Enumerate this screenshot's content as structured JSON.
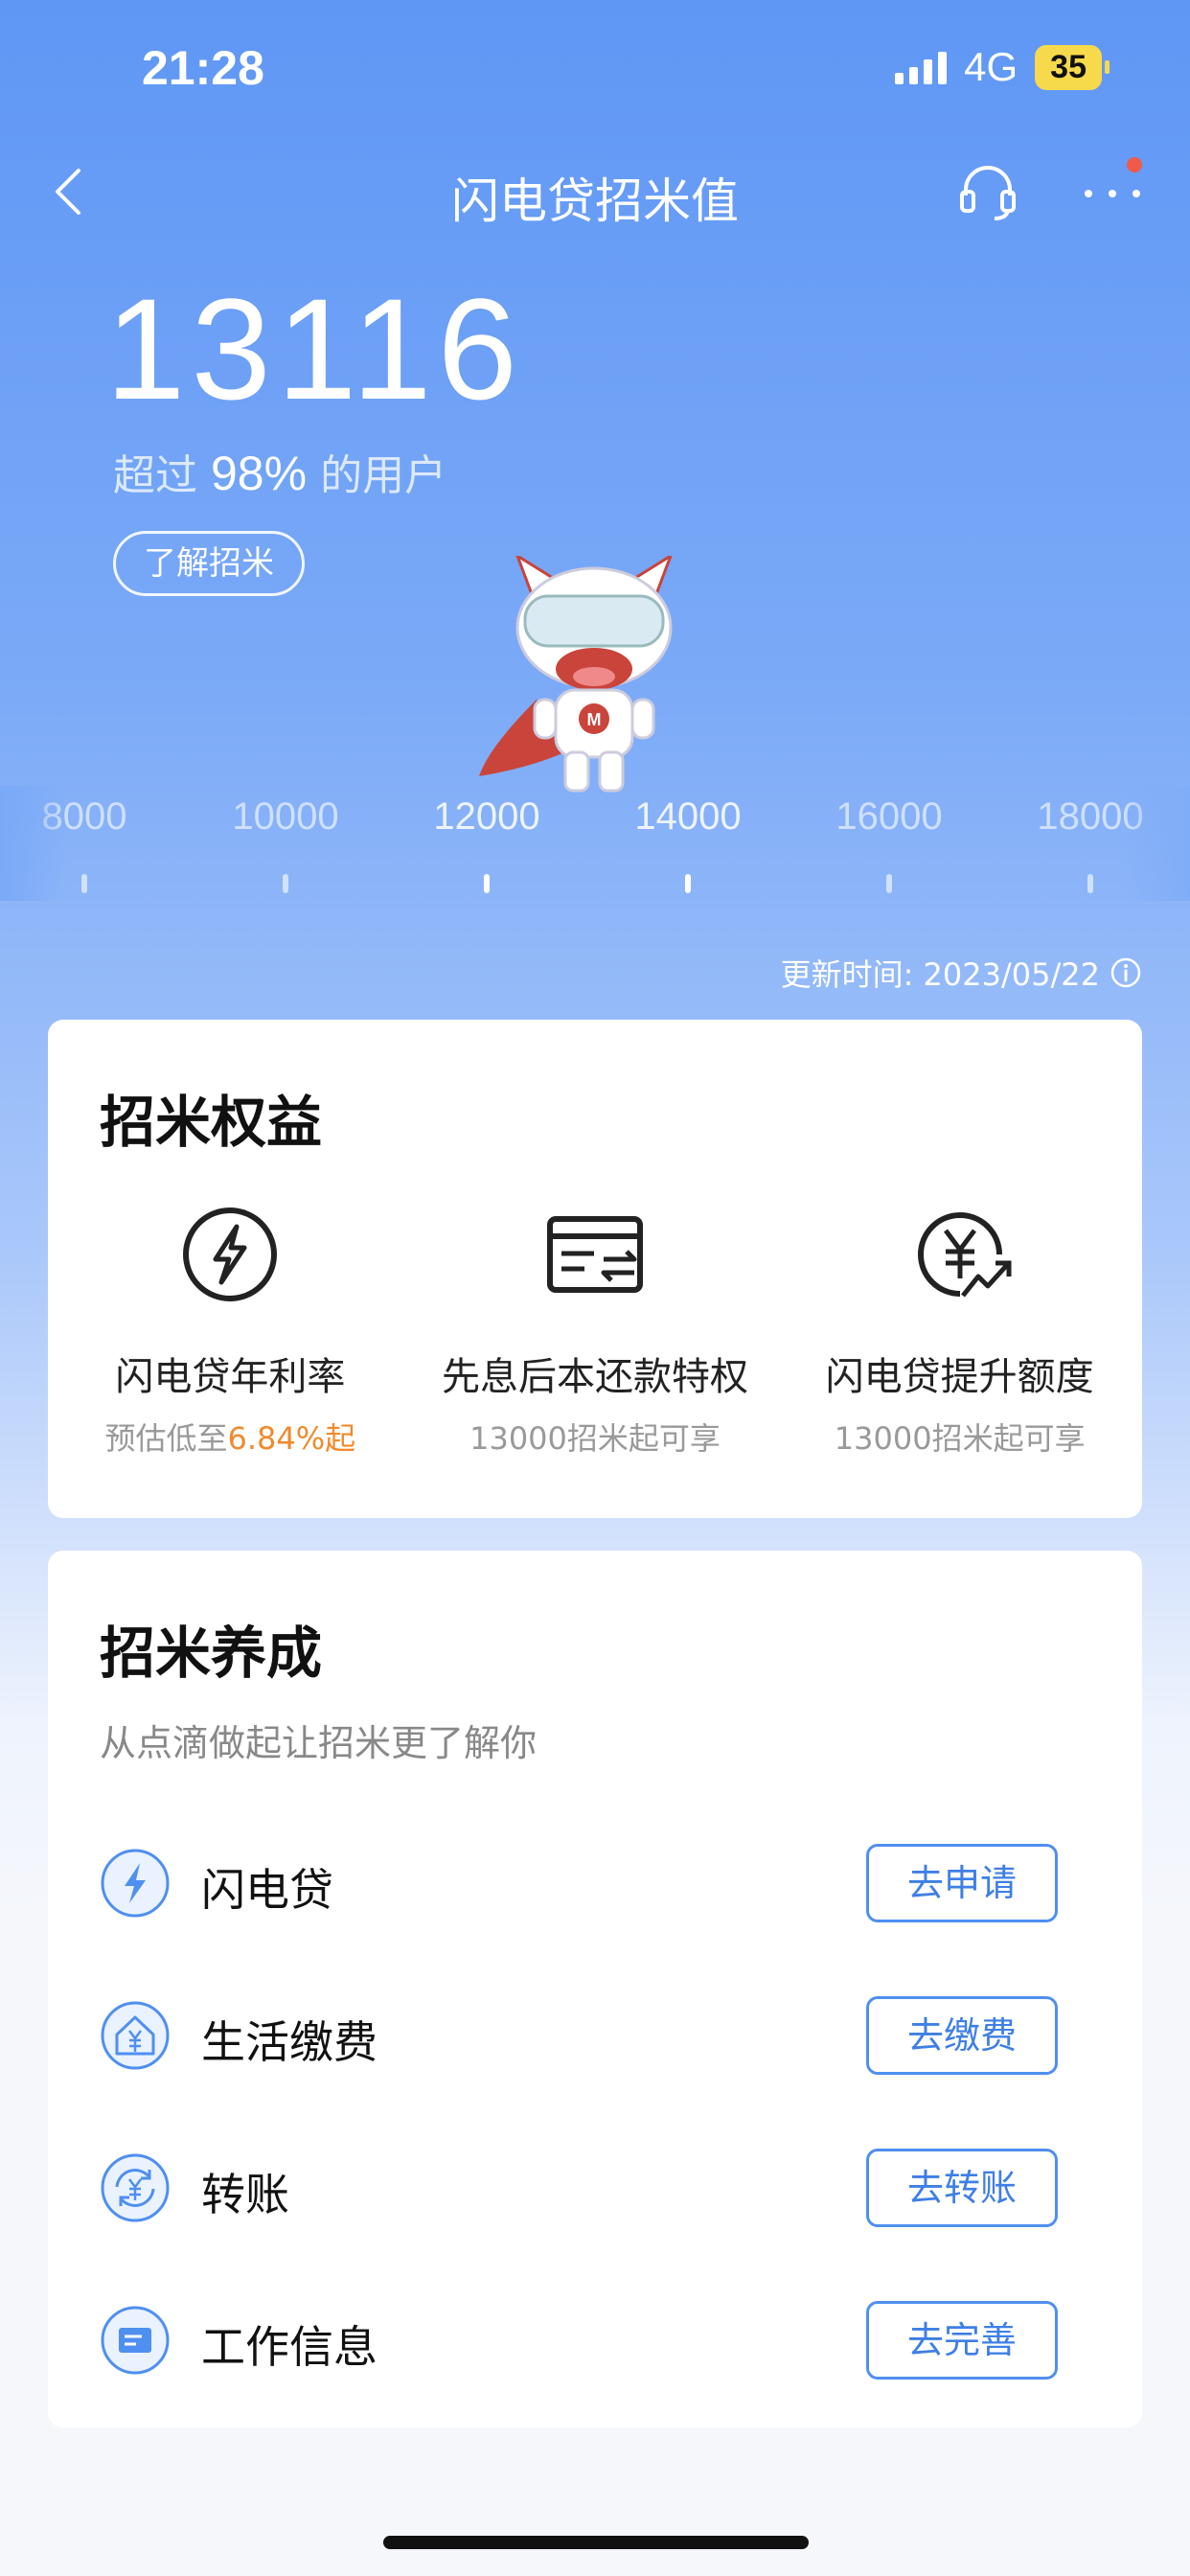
{
  "status_bar": {
    "time": "21:28",
    "network": "4G",
    "battery": "35"
  },
  "header": {
    "title": "闪电贷招米值",
    "back_icon": "chevron-left-icon",
    "service_icon": "headset-icon",
    "more_icon": "more-icon"
  },
  "score": {
    "value": "13116",
    "exceed_prefix": "超过",
    "exceed_percent": "98%",
    "exceed_suffix": "的用户",
    "learn_button": "了解招米"
  },
  "ruler": {
    "labels": [
      "8000",
      "10000",
      "12000",
      "14000",
      "16000",
      "18000"
    ],
    "current_value": 13116
  },
  "update_time": "更新时间: 2023/05/22",
  "benefits_card": {
    "title": "招米权益",
    "items": [
      {
        "icon": "lightning-circle-icon",
        "title": "闪电贷年利率",
        "desc_prefix": "预估低至",
        "desc_highlight": "6.84%起"
      },
      {
        "icon": "card-transfer-icon",
        "title": "先息后本还款特权",
        "desc": "13000招米起可享"
      },
      {
        "icon": "yen-growth-icon",
        "title": "闪电贷提升额度",
        "desc": "13000招米起可享"
      }
    ]
  },
  "cultivate_card": {
    "title": "招米养成",
    "subtitle": "从点滴做起让招米更了解你",
    "tasks": [
      {
        "icon": "lightning-icon",
        "label": "闪电贷",
        "button": "去申请"
      },
      {
        "icon": "house-yen-icon",
        "label": "生活缴费",
        "button": "去缴费"
      },
      {
        "icon": "yen-cycle-icon",
        "label": "转账",
        "button": "去转账"
      },
      {
        "icon": "id-card-icon",
        "label": "工作信息",
        "button": "去完善"
      }
    ]
  },
  "colors": {
    "accent": "#3e7fe6",
    "highlight": "#f08a2c",
    "background_top": "#5f97f5"
  }
}
